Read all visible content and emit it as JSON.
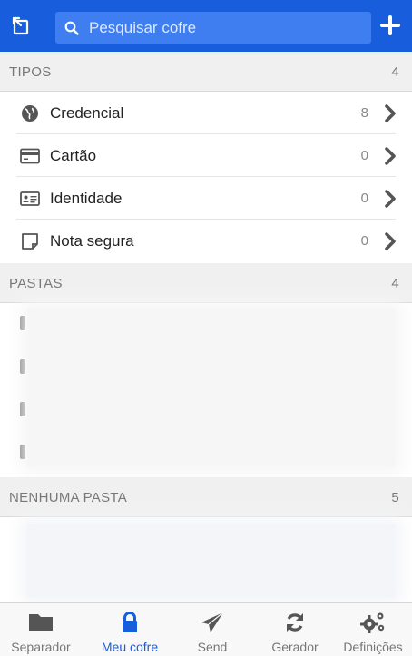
{
  "header": {
    "search_placeholder": "Pesquisar cofre"
  },
  "types": {
    "label": "TIPOS",
    "count": "4",
    "items": [
      {
        "name": "Credencial",
        "count": "8",
        "icon": "globe-icon"
      },
      {
        "name": "Cartão",
        "count": "0",
        "icon": "credit-card-icon"
      },
      {
        "name": "Identidade",
        "count": "0",
        "icon": "id-card-icon"
      },
      {
        "name": "Nota segura",
        "count": "0",
        "icon": "sticky-note-icon"
      }
    ]
  },
  "folders": {
    "label": "PASTAS",
    "count": "4"
  },
  "no_folder": {
    "label": "NENHUMA PASTA",
    "count": "5"
  },
  "nav": {
    "tabs": [
      {
        "label": "Separador",
        "icon": "folder-icon"
      },
      {
        "label": "Meu cofre",
        "icon": "lock-icon",
        "active": true
      },
      {
        "label": "Send",
        "icon": "paper-plane-icon"
      },
      {
        "label": "Gerador",
        "icon": "refresh-icon"
      },
      {
        "label": "Definições",
        "icon": "gears-icon"
      }
    ]
  },
  "colors": {
    "brand": "#175ddc",
    "search_bg": "#3f7ef0",
    "muted_icon": "#555555"
  }
}
